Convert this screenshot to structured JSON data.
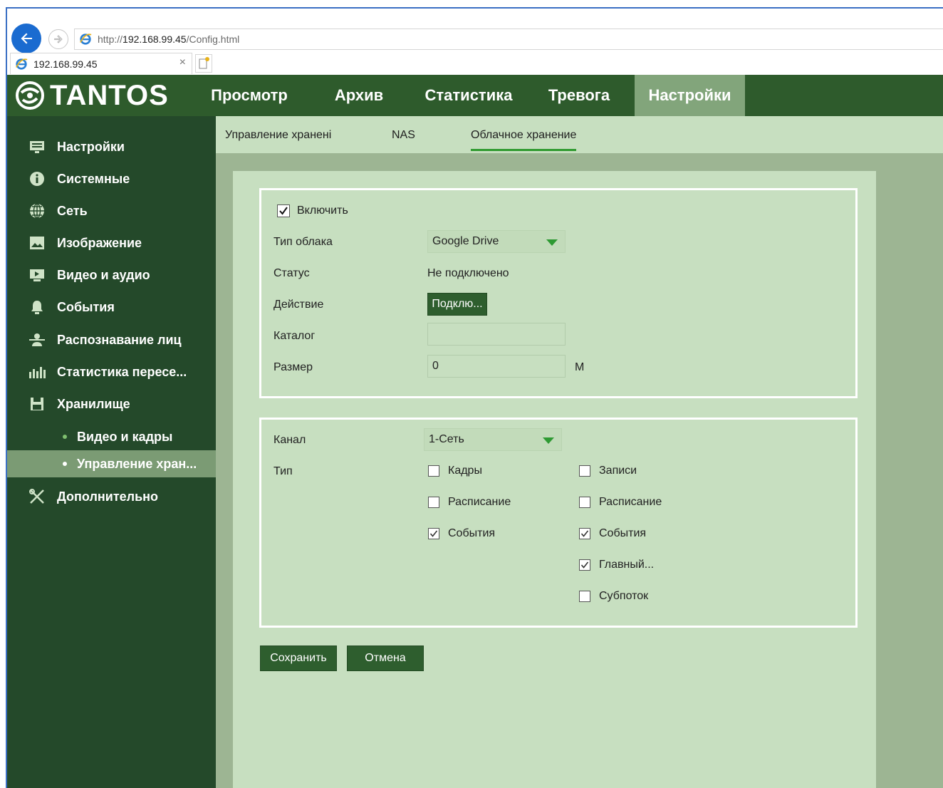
{
  "browser": {
    "url_prefix": "http://",
    "url_host": "192.168.99.45",
    "url_path": "/Config.html",
    "tab_title": "192.168.99.45",
    "tab_close": "×"
  },
  "brand": {
    "name": "TANTOS"
  },
  "topnav": {
    "items": [
      {
        "label": "Просмотр"
      },
      {
        "label": "Архив"
      },
      {
        "label": "Статистика"
      },
      {
        "label": "Тревога"
      },
      {
        "label": "Настройки"
      }
    ]
  },
  "sidebar": {
    "items": [
      {
        "label": "Настройки",
        "icon": "settings-list-icon"
      },
      {
        "label": "Системные",
        "icon": "info-icon"
      },
      {
        "label": "Сеть",
        "icon": "globe-icon"
      },
      {
        "label": "Изображение",
        "icon": "image-icon"
      },
      {
        "label": "Видео и аудио",
        "icon": "video-icon"
      },
      {
        "label": "События",
        "icon": "bell-icon"
      },
      {
        "label": "Распознавание лиц",
        "icon": "face-icon"
      },
      {
        "label": "Статистика пересе...",
        "icon": "bar-chart-icon"
      },
      {
        "label": "Хранилище",
        "icon": "floppy-icon"
      },
      {
        "label": "Видео и кадры"
      },
      {
        "label": "Управление хран..."
      },
      {
        "label": "Дополнительно",
        "icon": "tools-icon"
      }
    ]
  },
  "subtabs": [
    {
      "label": "Управление хранені"
    },
    {
      "label": "NAS"
    },
    {
      "label": "Облачное хранение"
    }
  ],
  "cloud": {
    "enable_label": "Включить",
    "enable_checked": true,
    "type_label": "Тип облака",
    "type_value": "Google Drive",
    "status_label": "Статус",
    "status_value": "Не подключено",
    "action_label": "Действие",
    "action_button": "Подклю...",
    "catalog_label": "Каталог",
    "catalog_value": "",
    "size_label": "Размер",
    "size_value": "0",
    "size_unit": "M"
  },
  "channel": {
    "channel_label": "Канал",
    "channel_value": "1-Сеть",
    "type_label": "Тип",
    "left": [
      {
        "label": "Кадры",
        "checked": false
      },
      {
        "label": "Расписание",
        "checked": false
      },
      {
        "label": "События",
        "checked": true
      }
    ],
    "right": [
      {
        "label": "Записи",
        "checked": false
      },
      {
        "label": "Расписание",
        "checked": false
      },
      {
        "label": "События",
        "checked": true
      },
      {
        "label": "Главный...",
        "checked": true
      },
      {
        "label": "Субпоток",
        "checked": false
      }
    ]
  },
  "actions": {
    "save": "Сохранить",
    "cancel": "Отмена"
  }
}
